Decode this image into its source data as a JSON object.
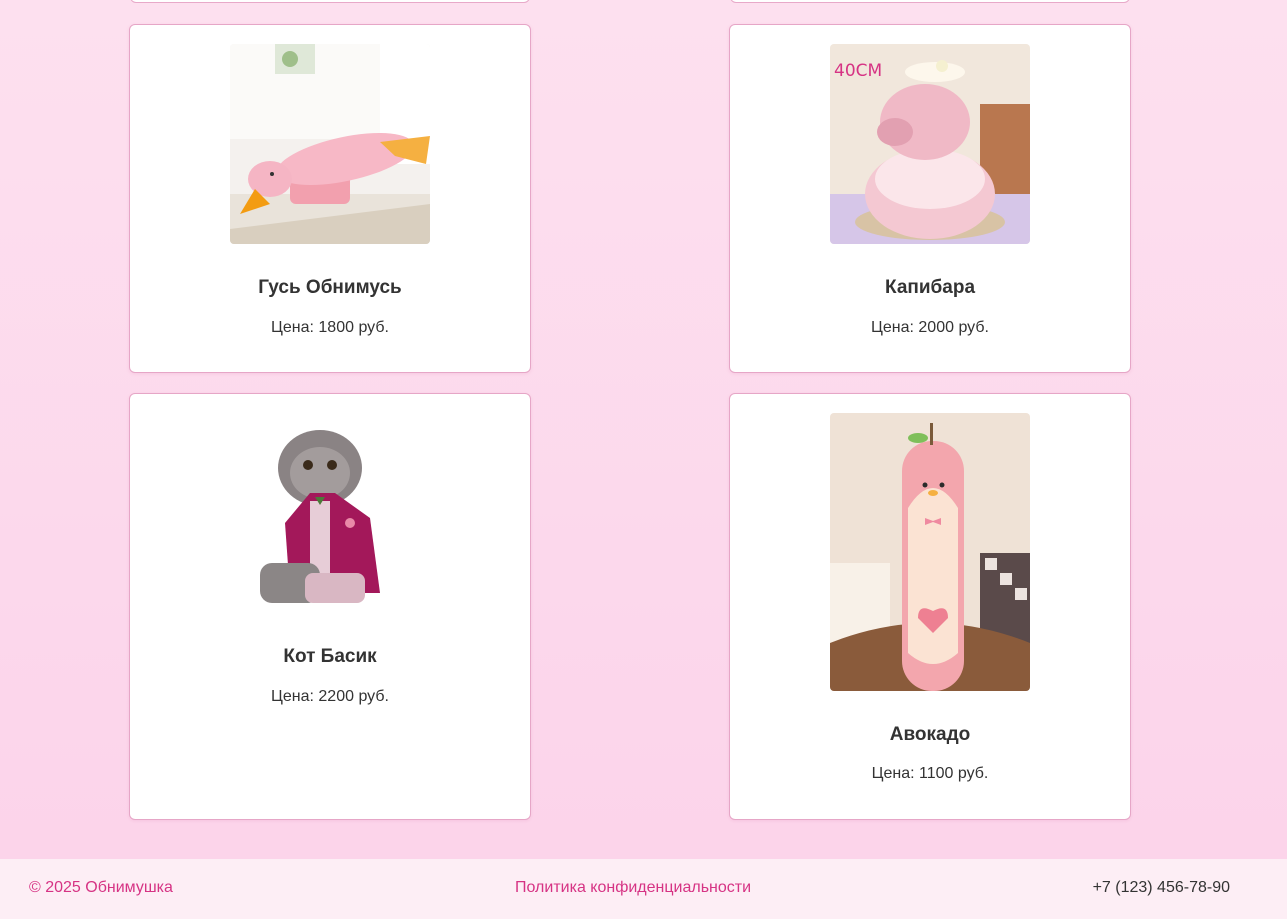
{
  "products": [
    {
      "name": "Гусь Обнимусь",
      "price": "Цена: 1800 руб."
    },
    {
      "name": "Капибара",
      "price": "Цена: 2000 руб.",
      "image_text": "40CM"
    },
    {
      "name": "Кот Басик",
      "price": "Цена: 2200 руб."
    },
    {
      "name": "Авокадо",
      "price": "Цена: 1100 руб."
    }
  ],
  "footer": {
    "copyright": "© 2025 Обнимушка",
    "policy_link": "Политика конфиденциальности",
    "phone": "+7 (123) 456-78-90"
  },
  "colors": {
    "accent": "#d63384",
    "background": "#fcd8ec",
    "card_border": "#e6a6c7"
  }
}
